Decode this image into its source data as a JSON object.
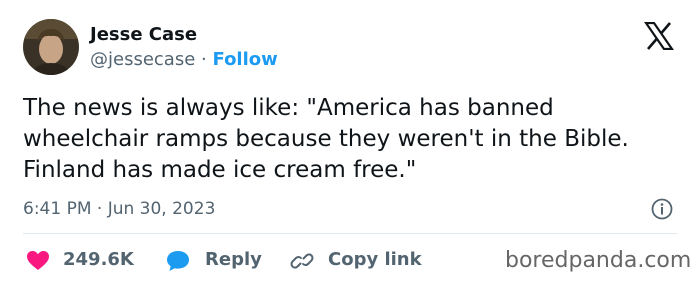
{
  "author": {
    "display_name": "Jesse Case",
    "handle": "@jessecase",
    "separator": "·",
    "follow_label": "Follow"
  },
  "tweet": {
    "text": "The news is always like: \"America has banned wheelchair ramps because they weren't in the Bible. Finland has made ice cream free.\"",
    "timestamp": "6:41 PM · Jun 30, 2023"
  },
  "actions": {
    "like_count": "249.6K",
    "reply_label": "Reply",
    "copy_link_label": "Copy link"
  },
  "icons": {
    "platform": "x-logo-icon",
    "info": "info-icon",
    "like": "heart-icon",
    "reply": "speech-bubble-icon",
    "copy_link": "link-icon"
  },
  "colors": {
    "follow": "#1d9bf0",
    "like": "#f91880",
    "reply": "#1d9bf0",
    "muted": "#536471"
  },
  "watermark": "boredpanda.com"
}
